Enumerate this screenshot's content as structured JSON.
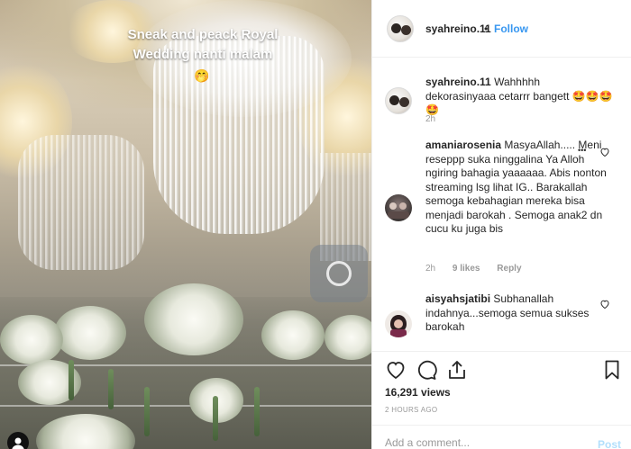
{
  "post": {
    "overlay_caption": "Sneak and peack Royal Wedding nanti malam",
    "overlay_emoji": "🤭"
  },
  "header": {
    "username": "syahreino.11",
    "separator": "•",
    "follow_label": "Follow"
  },
  "comments": [
    {
      "username": "syahreino.11",
      "text": "Wahhhhh dekorasinyaaa cetarrr bangett 🤩🤩🤩🤩",
      "time": "2h"
    },
    {
      "username": "amaniarosenia",
      "text": "MasyaAllah..... Meni reseppp suka ninggalina Ya Alloh ngiring bahagia yaaaaaa. Abis nonton streaming lsg lihat IG.. Barakallah semoga kebahagian mereka bisa menjadi barokah . Semoga anak2 dn cucu ku juga bis",
      "time": "2h",
      "likes": "9 likes",
      "reply_label": "Reply",
      "more": "•••"
    },
    {
      "username": "aisyahsjatibi",
      "text": "Subhanallah indahnya...semoga semua sukses barokah"
    }
  ],
  "stats": {
    "views": "16,291 views",
    "posted": "2 HOURS AGO"
  },
  "composer": {
    "placeholder": "Add a comment...",
    "post_label": "Post"
  },
  "colors": {
    "link_blue": "#3897f0",
    "post_disabled": "#b2dffc",
    "meta_gray": "#999999"
  }
}
